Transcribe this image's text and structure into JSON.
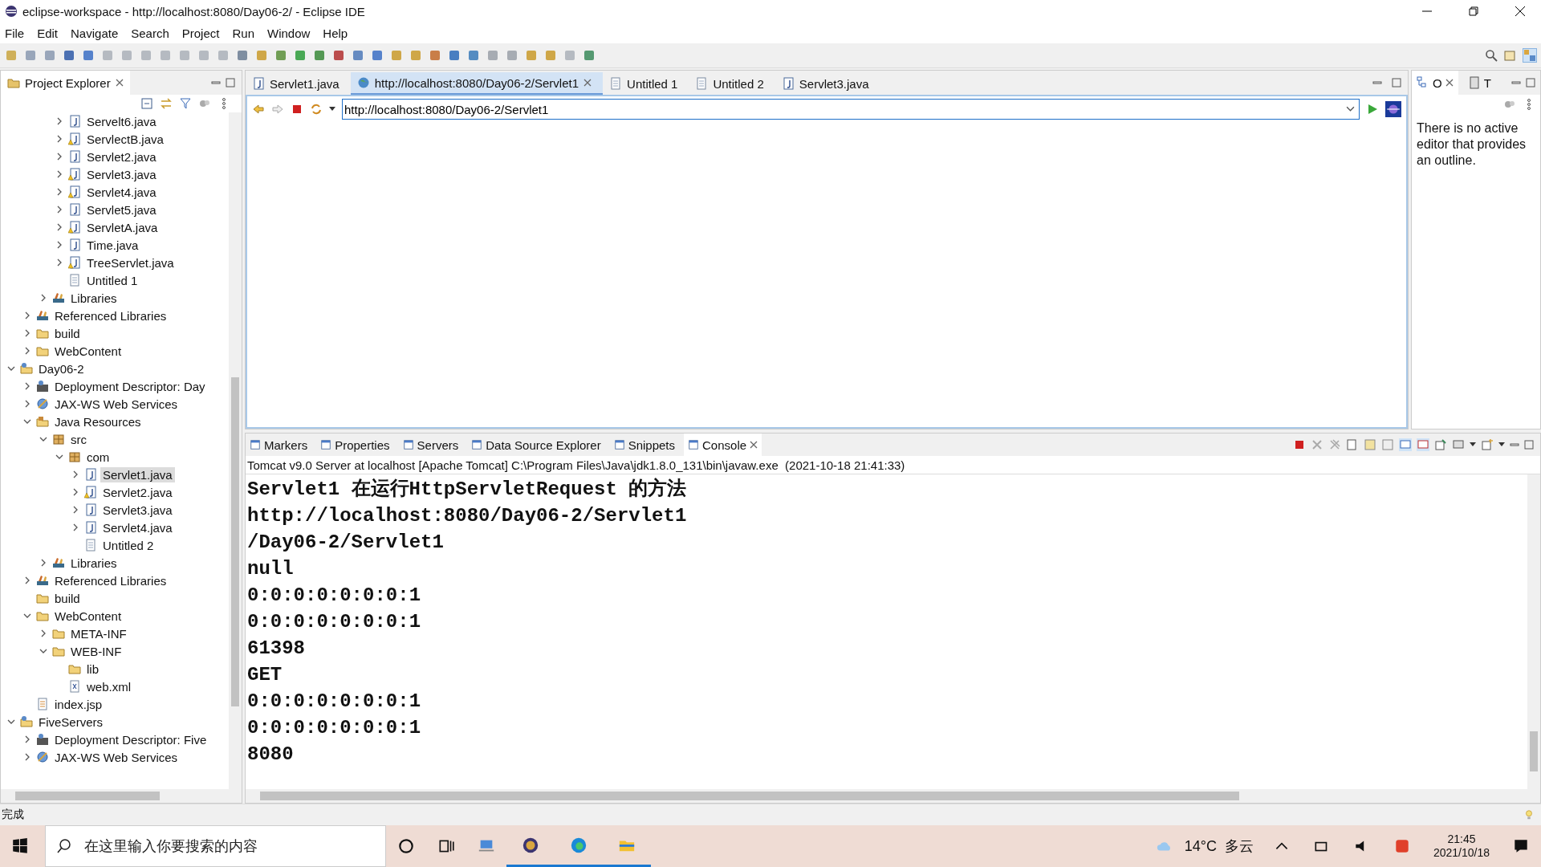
{
  "window": {
    "title": "eclipse-workspace - http://localhost:8080/Day06-2/ - Eclipse IDE"
  },
  "menu": [
    "File",
    "Edit",
    "Navigate",
    "Search",
    "Project",
    "Run",
    "Window",
    "Help"
  ],
  "project_explorer": {
    "title": "Project Explorer",
    "tree": [
      {
        "children": [
          {
            "children": [
              {
                "children": [
                  {
                    "label": "Servelt6.java",
                    "kind": "java",
                    "expanded": false,
                    "selected": false
                  },
                  {
                    "label": "ServlectB.java",
                    "kind": "java-warn",
                    "expanded": false,
                    "selected": false
                  },
                  {
                    "label": "Servlet2.java",
                    "kind": "java",
                    "expanded": false,
                    "selected": false
                  },
                  {
                    "label": "Servlet3.java",
                    "kind": "java-warn",
                    "expanded": false,
                    "selected": false
                  },
                  {
                    "label": "Servlet4.java",
                    "kind": "java-warn",
                    "expanded": false,
                    "selected": false
                  },
                  {
                    "label": "Servlet5.java",
                    "kind": "java",
                    "expanded": false,
                    "selected": false
                  },
                  {
                    "label": "ServletA.java",
                    "kind": "java-warn",
                    "expanded": false,
                    "selected": false
                  },
                  {
                    "label": "Time.java",
                    "kind": "java",
                    "expanded": false,
                    "selected": false
                  },
                  {
                    "label": "TreeServlet.java",
                    "kind": "java-warn",
                    "expanded": false,
                    "selected": false
                  },
                  {
                    "label": "Untitled 1",
                    "kind": "file",
                    "selected": false
                  }
                ]
              },
              {
                "label": "Libraries",
                "kind": "library",
                "expanded": false,
                "selected": false
              }
            ]
          },
          {
            "label": "Referenced Libraries",
            "kind": "library",
            "expanded": false,
            "selected": false
          },
          {
            "label": "build",
            "kind": "folder",
            "expanded": false,
            "selected": false
          },
          {
            "label": "WebContent",
            "kind": "folder",
            "expanded": false,
            "selected": false
          }
        ]
      },
      {
        "label": "Day06-2",
        "kind": "project",
        "expanded": true,
        "selected": false,
        "children": [
          {
            "label": "Deployment Descriptor: Day",
            "kind": "descriptor",
            "expanded": false,
            "selected": false
          },
          {
            "label": "JAX-WS Web Services",
            "kind": "webservice",
            "expanded": false,
            "selected": false
          },
          {
            "label": "Java Resources",
            "kind": "javares",
            "expanded": true,
            "selected": false,
            "children": [
              {
                "label": "src",
                "kind": "package",
                "expanded": true,
                "selected": false,
                "children": [
                  {
                    "label": "com",
                    "kind": "package",
                    "expanded": true,
                    "selected": false,
                    "children": [
                      {
                        "label": "Servlet1.java",
                        "kind": "java",
                        "expanded": false,
                        "selected": true
                      },
                      {
                        "label": "Servlet2.java",
                        "kind": "java-warn",
                        "expanded": false,
                        "selected": false
                      },
                      {
                        "label": "Servlet3.java",
                        "kind": "java",
                        "expanded": false,
                        "selected": false
                      },
                      {
                        "label": "Servlet4.java",
                        "kind": "java",
                        "expanded": false,
                        "selected": false
                      },
                      {
                        "label": "Untitled 2",
                        "kind": "file",
                        "selected": false
                      }
                    ]
                  }
                ]
              },
              {
                "label": "Libraries",
                "kind": "library",
                "expanded": false,
                "selected": false
              }
            ]
          },
          {
            "label": "Referenced Libraries",
            "kind": "library",
            "expanded": false,
            "selected": false
          },
          {
            "label": "build",
            "kind": "folder",
            "selected": false
          },
          {
            "label": "WebContent",
            "kind": "folder",
            "expanded": true,
            "selected": false,
            "children": [
              {
                "label": "META-INF",
                "kind": "folder",
                "expanded": false,
                "selected": false
              },
              {
                "label": "WEB-INF",
                "kind": "folder",
                "expanded": true,
                "selected": false,
                "children": [
                  {
                    "label": "lib",
                    "kind": "folder",
                    "selected": false
                  },
                  {
                    "label": "web.xml",
                    "kind": "xml",
                    "selected": false
                  }
                ]
              }
            ]
          },
          {
            "label": "index.jsp",
            "kind": "jsp",
            "selected": false
          }
        ]
      },
      {
        "label": "FiveServers",
        "kind": "project",
        "expanded": true,
        "selected": false,
        "children": [
          {
            "label": "Deployment Descriptor: Five",
            "kind": "descriptor",
            "expanded": false,
            "selected": false
          },
          {
            "label": "JAX-WS Web Services",
            "kind": "webservice",
            "expanded": false,
            "selected": false
          }
        ]
      }
    ]
  },
  "editor_tabs": [
    {
      "label": "Servlet1.java",
      "kind": "java",
      "selected": false
    },
    {
      "label": "http://localhost:8080/Day06-2/Servlet1",
      "kind": "web",
      "selected": true
    },
    {
      "label": "Untitled 1",
      "kind": "file",
      "selected": false
    },
    {
      "label": "Untitled 2",
      "kind": "file",
      "selected": false
    },
    {
      "label": "Servlet3.java",
      "kind": "java",
      "selected": false
    }
  ],
  "browser": {
    "url": "http://localhost:8080/Day06-2/Servlet1"
  },
  "outline": {
    "tabs": [
      {
        "label": "O",
        "selected": true
      },
      {
        "label": "T",
        "selected": false
      }
    ],
    "message": "There is no active editor that provides an outline."
  },
  "console": {
    "tabs": [
      {
        "label": "Markers",
        "selected": false
      },
      {
        "label": "Properties",
        "selected": false
      },
      {
        "label": "Servers",
        "selected": false
      },
      {
        "label": "Data Source Explorer",
        "selected": false
      },
      {
        "label": "Snippets",
        "selected": false
      },
      {
        "label": "Console",
        "selected": true
      }
    ],
    "header": "Tomcat v9.0 Server at localhost [Apache Tomcat] C:\\Program Files\\Java\\jdk1.8.0_131\\bin\\javaw.exe  (2021-10-18 21:41:33)",
    "lines": [
      "Servlet1 在运行HttpServletRequest 的方法",
      "http://localhost:8080/Day06-2/Servlet1",
      "/Day06-2/Servlet1",
      "null",
      "0:0:0:0:0:0:0:1",
      "0:0:0:0:0:0:0:1",
      "61398",
      "GET",
      "0:0:0:0:0:0:0:1",
      "0:0:0:0:0:0:0:1",
      "8080"
    ]
  },
  "status_bar": {
    "text": "完成"
  },
  "taskbar": {
    "search_placeholder": "在这里输入你要搜索的内容",
    "temperature": "14°C",
    "weather": "多云",
    "time": "21:45",
    "date": "2021/10/18"
  }
}
